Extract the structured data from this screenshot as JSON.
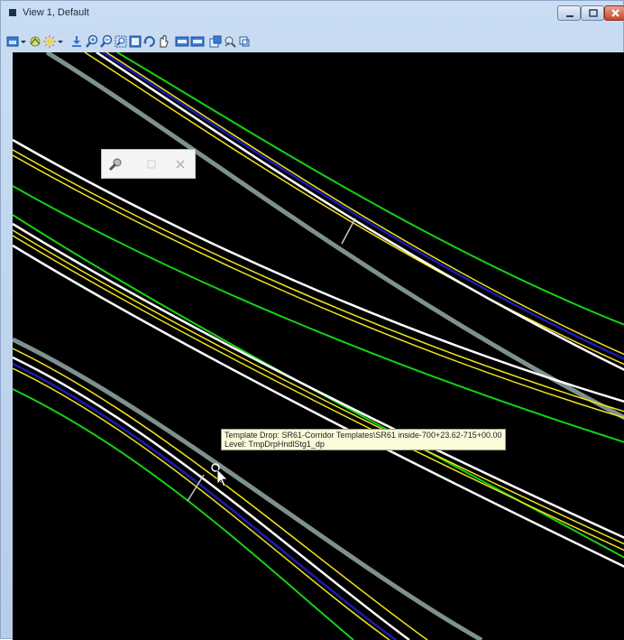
{
  "window": {
    "title": "View 1, Default"
  },
  "toolbar": {
    "icons": [
      "view-attributes-icon",
      "dropdown-arrow",
      "display-style-icon",
      "lighting-icon",
      "dropdown-arrow",
      "update-view-icon",
      "zoom-in-icon",
      "zoom-out-icon",
      "window-area-icon",
      "fit-view-icon",
      "rotate-view-icon",
      "pan-view-icon",
      "view-previous-icon",
      "view-next-icon",
      "copy-view-icon",
      "clip-volume-icon",
      "change-view-perspective-icon"
    ]
  },
  "tooltip": {
    "line1": "Template Drop: SR61-Corridor Templates\\SR61 inside-700+23.62-715+00.00",
    "line2": "Level: TmpDrpHndlStg1_dp"
  },
  "colors": {
    "canvas_bg": "#000000",
    "line_white": "#ffffff",
    "line_yellow": "#f5e41b",
    "line_green": "#14d214",
    "line_blue": "#1a1ab3",
    "line_gray": "#7e918e"
  }
}
